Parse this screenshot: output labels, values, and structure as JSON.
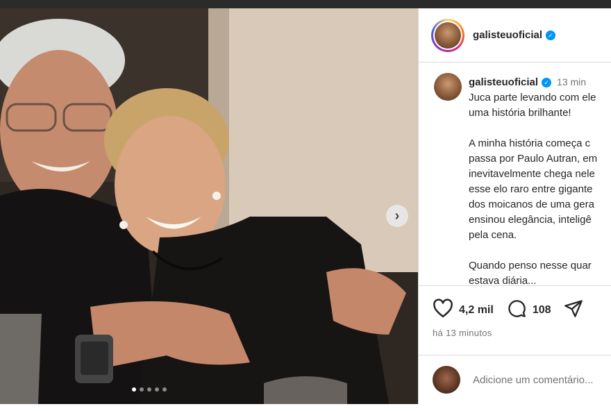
{
  "post": {
    "username": "galisteuoficial",
    "verified_icon": "verified-badge-icon",
    "caption_time": "13 min",
    "caption_paragraphs": [
      "Juca parte levando com ele\numa história brilhante!",
      "A minha história começa c\npassa por Paulo Autran, em\ninevitavelmente chega nele\nesse elo raro entre gigante\ndos moicanos de uma gera\nensinou elegância, inteligê\npela cena.",
      "Quando penso nesse quar\nestava diária..."
    ],
    "likes": "4,2 mil",
    "comments": "108",
    "time_ago": "há 13 minutos",
    "add_comment_placeholder": "Adicione um comentário..."
  },
  "carousel": {
    "dot_count": 5,
    "active_dot": 0,
    "next_icon": "chevron-right-icon"
  },
  "colors": {
    "accent_blue": "#0095f6",
    "border": "#dbdbdb",
    "muted_text": "#737373"
  }
}
